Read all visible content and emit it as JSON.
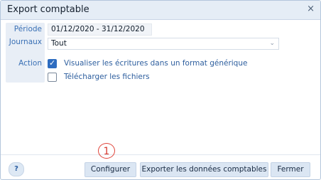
{
  "dialog": {
    "title": "Export comptable",
    "close_glyph": "×"
  },
  "form": {
    "period_label": "Période",
    "period_value": "01/12/2020 - 31/12/2020",
    "journals_label": "Journaux",
    "journals_value": "Tout",
    "action_label": "Action",
    "options": [
      {
        "label": "Visualiser les écritures dans un format générique",
        "checked": true
      },
      {
        "label": "Télécharger les fichiers",
        "checked": false
      }
    ]
  },
  "footer": {
    "help_label": "?",
    "configure_label": "Configurer",
    "export_label": "Exporter les données comptables",
    "close_label": "Fermer"
  },
  "annotation": {
    "step_number": "1",
    "color": "#e0443a"
  },
  "colors": {
    "titlebar_bg": "#e5edf6",
    "button_bg": "#dbe6f3",
    "label_color": "#3a70b5",
    "checkbox_accent": "#2d6cc0"
  },
  "icons": {
    "close": "close-icon",
    "chevron": "chevron-down-icon",
    "check": "check-icon",
    "help": "help-icon"
  }
}
